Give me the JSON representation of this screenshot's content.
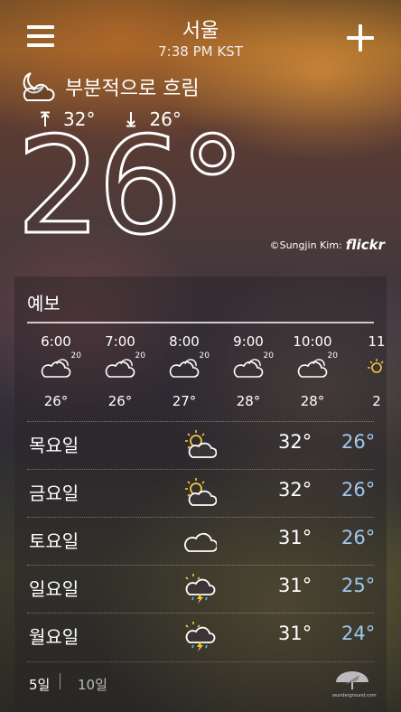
{
  "header": {
    "city": "서울",
    "time": "7:38 PM KST"
  },
  "current": {
    "condition": "부분적으로 흐림",
    "condition_icon": "partly-cloudy-night-icon",
    "high": "32°",
    "low": "26°",
    "temperature": "26",
    "degree_symbol": "°"
  },
  "photo_credit": {
    "text": "©Sungjin Kim:",
    "brand": "flickr"
  },
  "forecast": {
    "title": "예보",
    "hourly": [
      {
        "time": "6:00",
        "pop": "20",
        "temp": "26°",
        "icon": "partly-cloudy-icon"
      },
      {
        "time": "7:00",
        "pop": "20",
        "temp": "26°",
        "icon": "partly-cloudy-icon"
      },
      {
        "time": "8:00",
        "pop": "20",
        "temp": "27°",
        "icon": "partly-cloudy-icon"
      },
      {
        "time": "9:00",
        "pop": "20",
        "temp": "28°",
        "icon": "partly-cloudy-icon"
      },
      {
        "time": "10:00",
        "pop": "20",
        "temp": "28°",
        "icon": "partly-cloudy-icon"
      },
      {
        "time": "11",
        "pop": "",
        "temp": "2",
        "icon": "sun-icon"
      }
    ],
    "daily": [
      {
        "day": "목요일",
        "icon": "partly-sunny-icon",
        "high": "32°",
        "low": "26°"
      },
      {
        "day": "금요일",
        "icon": "partly-sunny-icon",
        "high": "32°",
        "low": "26°"
      },
      {
        "day": "토요일",
        "icon": "cloud-icon",
        "high": "31°",
        "low": "26°"
      },
      {
        "day": "일요일",
        "icon": "thunderstorm-icon",
        "high": "31°",
        "low": "25°"
      },
      {
        "day": "월요일",
        "icon": "thunderstorm-icon",
        "high": "31°",
        "low": "24°"
      }
    ],
    "tabs": {
      "five_day": "5일",
      "ten_day": "10일"
    },
    "provider": "wunderground.com"
  }
}
